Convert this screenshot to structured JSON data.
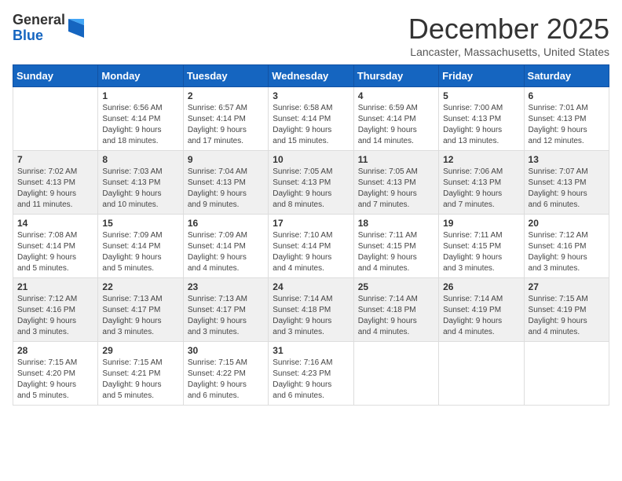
{
  "logo": {
    "general": "General",
    "blue": "Blue"
  },
  "header": {
    "month": "December 2025",
    "location": "Lancaster, Massachusetts, United States"
  },
  "days_of_week": [
    "Sunday",
    "Monday",
    "Tuesday",
    "Wednesday",
    "Thursday",
    "Friday",
    "Saturday"
  ],
  "weeks": [
    [
      {
        "day": "",
        "info": ""
      },
      {
        "day": "1",
        "info": "Sunrise: 6:56 AM\nSunset: 4:14 PM\nDaylight: 9 hours\nand 18 minutes."
      },
      {
        "day": "2",
        "info": "Sunrise: 6:57 AM\nSunset: 4:14 PM\nDaylight: 9 hours\nand 17 minutes."
      },
      {
        "day": "3",
        "info": "Sunrise: 6:58 AM\nSunset: 4:14 PM\nDaylight: 9 hours\nand 15 minutes."
      },
      {
        "day": "4",
        "info": "Sunrise: 6:59 AM\nSunset: 4:14 PM\nDaylight: 9 hours\nand 14 minutes."
      },
      {
        "day": "5",
        "info": "Sunrise: 7:00 AM\nSunset: 4:13 PM\nDaylight: 9 hours\nand 13 minutes."
      },
      {
        "day": "6",
        "info": "Sunrise: 7:01 AM\nSunset: 4:13 PM\nDaylight: 9 hours\nand 12 minutes."
      }
    ],
    [
      {
        "day": "7",
        "info": "Sunrise: 7:02 AM\nSunset: 4:13 PM\nDaylight: 9 hours\nand 11 minutes."
      },
      {
        "day": "8",
        "info": "Sunrise: 7:03 AM\nSunset: 4:13 PM\nDaylight: 9 hours\nand 10 minutes."
      },
      {
        "day": "9",
        "info": "Sunrise: 7:04 AM\nSunset: 4:13 PM\nDaylight: 9 hours\nand 9 minutes."
      },
      {
        "day": "10",
        "info": "Sunrise: 7:05 AM\nSunset: 4:13 PM\nDaylight: 9 hours\nand 8 minutes."
      },
      {
        "day": "11",
        "info": "Sunrise: 7:05 AM\nSunset: 4:13 PM\nDaylight: 9 hours\nand 7 minutes."
      },
      {
        "day": "12",
        "info": "Sunrise: 7:06 AM\nSunset: 4:13 PM\nDaylight: 9 hours\nand 7 minutes."
      },
      {
        "day": "13",
        "info": "Sunrise: 7:07 AM\nSunset: 4:13 PM\nDaylight: 9 hours\nand 6 minutes."
      }
    ],
    [
      {
        "day": "14",
        "info": "Sunrise: 7:08 AM\nSunset: 4:14 PM\nDaylight: 9 hours\nand 5 minutes."
      },
      {
        "day": "15",
        "info": "Sunrise: 7:09 AM\nSunset: 4:14 PM\nDaylight: 9 hours\nand 5 minutes."
      },
      {
        "day": "16",
        "info": "Sunrise: 7:09 AM\nSunset: 4:14 PM\nDaylight: 9 hours\nand 4 minutes."
      },
      {
        "day": "17",
        "info": "Sunrise: 7:10 AM\nSunset: 4:14 PM\nDaylight: 9 hours\nand 4 minutes."
      },
      {
        "day": "18",
        "info": "Sunrise: 7:11 AM\nSunset: 4:15 PM\nDaylight: 9 hours\nand 4 minutes."
      },
      {
        "day": "19",
        "info": "Sunrise: 7:11 AM\nSunset: 4:15 PM\nDaylight: 9 hours\nand 3 minutes."
      },
      {
        "day": "20",
        "info": "Sunrise: 7:12 AM\nSunset: 4:16 PM\nDaylight: 9 hours\nand 3 minutes."
      }
    ],
    [
      {
        "day": "21",
        "info": "Sunrise: 7:12 AM\nSunset: 4:16 PM\nDaylight: 9 hours\nand 3 minutes."
      },
      {
        "day": "22",
        "info": "Sunrise: 7:13 AM\nSunset: 4:17 PM\nDaylight: 9 hours\nand 3 minutes."
      },
      {
        "day": "23",
        "info": "Sunrise: 7:13 AM\nSunset: 4:17 PM\nDaylight: 9 hours\nand 3 minutes."
      },
      {
        "day": "24",
        "info": "Sunrise: 7:14 AM\nSunset: 4:18 PM\nDaylight: 9 hours\nand 3 minutes."
      },
      {
        "day": "25",
        "info": "Sunrise: 7:14 AM\nSunset: 4:18 PM\nDaylight: 9 hours\nand 4 minutes."
      },
      {
        "day": "26",
        "info": "Sunrise: 7:14 AM\nSunset: 4:19 PM\nDaylight: 9 hours\nand 4 minutes."
      },
      {
        "day": "27",
        "info": "Sunrise: 7:15 AM\nSunset: 4:19 PM\nDaylight: 9 hours\nand 4 minutes."
      }
    ],
    [
      {
        "day": "28",
        "info": "Sunrise: 7:15 AM\nSunset: 4:20 PM\nDaylight: 9 hours\nand 5 minutes."
      },
      {
        "day": "29",
        "info": "Sunrise: 7:15 AM\nSunset: 4:21 PM\nDaylight: 9 hours\nand 5 minutes."
      },
      {
        "day": "30",
        "info": "Sunrise: 7:15 AM\nSunset: 4:22 PM\nDaylight: 9 hours\nand 6 minutes."
      },
      {
        "day": "31",
        "info": "Sunrise: 7:16 AM\nSunset: 4:23 PM\nDaylight: 9 hours\nand 6 minutes."
      },
      {
        "day": "",
        "info": ""
      },
      {
        "day": "",
        "info": ""
      },
      {
        "day": "",
        "info": ""
      }
    ]
  ]
}
